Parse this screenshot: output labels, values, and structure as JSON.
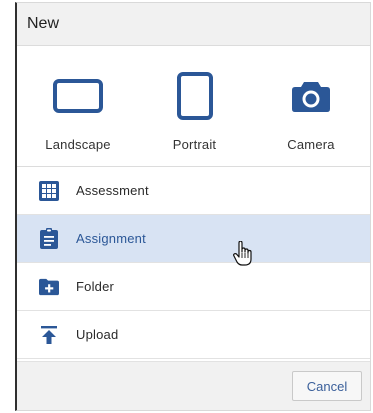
{
  "dialog": {
    "title": "New"
  },
  "tiles": [
    {
      "label": "Landscape",
      "icon": "landscape-icon"
    },
    {
      "label": "Portrait",
      "icon": "portrait-icon"
    },
    {
      "label": "Camera",
      "icon": "camera-icon"
    }
  ],
  "menu": [
    {
      "label": "Assessment",
      "icon": "grid-icon",
      "selected": false
    },
    {
      "label": "Assignment",
      "icon": "clipboard-icon",
      "selected": true
    },
    {
      "label": "Folder",
      "icon": "folder-add-icon",
      "selected": false
    },
    {
      "label": "Upload",
      "icon": "upload-icon",
      "selected": false
    }
  ],
  "footer": {
    "cancel_label": "Cancel"
  },
  "colors": {
    "accent": "#2b5797",
    "selected_row": "#d8e3f3",
    "header_bg": "#f1f1f1"
  }
}
